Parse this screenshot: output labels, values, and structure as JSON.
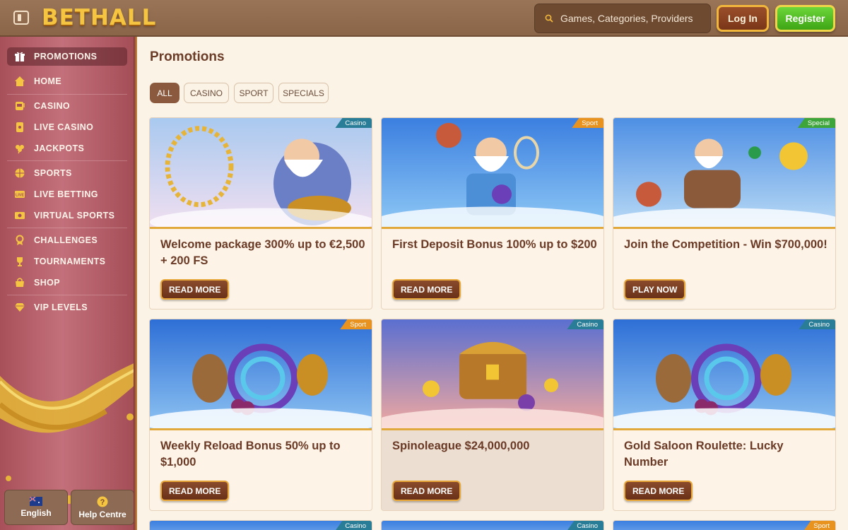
{
  "header": {
    "logo": "BETHALL",
    "search_placeholder": "Games, Categories, Providers",
    "login": "Log In",
    "register": "Register"
  },
  "sidebar": {
    "items": [
      {
        "label": "PROMOTIONS",
        "icon": "gift-icon",
        "active": true
      },
      {
        "label": "HOME",
        "icon": "home-icon"
      },
      {
        "label": "CASINO",
        "icon": "slot-icon"
      },
      {
        "label": "LIVE CASINO",
        "icon": "live-casino-icon"
      },
      {
        "label": "JACKPOTS",
        "icon": "clover-icon"
      },
      {
        "label": "SPORTS",
        "icon": "basketball-icon"
      },
      {
        "label": "LIVE BETTING",
        "icon": "live-icon"
      },
      {
        "label": "VIRTUAL SPORTS",
        "icon": "virtual-icon"
      },
      {
        "label": "CHALLENGES",
        "icon": "challenge-icon"
      },
      {
        "label": "TOURNAMENTS",
        "icon": "trophy-icon"
      },
      {
        "label": "SHOP",
        "icon": "shop-icon"
      },
      {
        "label": "VIP LEVELS",
        "icon": "diamond-icon"
      }
    ],
    "language": "English",
    "help": "Help Centre"
  },
  "main": {
    "title": "Promotions",
    "filters": [
      "ALL",
      "CASINO",
      "SPORT",
      "SPECIALS"
    ],
    "cards": [
      {
        "tag": "Casino",
        "title": "Welcome package 300% up to €2,500 + 200 FS",
        "button": "READ MORE"
      },
      {
        "tag": "Sport",
        "title": "First Deposit Bonus 100% up to $200",
        "button": "READ MORE"
      },
      {
        "tag": "Special",
        "title": "Join the Competition - Win $700,000!",
        "button": "PLAY NOW"
      },
      {
        "tag": "Sport",
        "title": "Weekly Reload Bonus 50% up to $1,000",
        "button": "READ MORE"
      },
      {
        "tag": "Casino",
        "title": "Spinoleague $24,000,000",
        "button": "READ MORE"
      },
      {
        "tag": "Casino",
        "title": "Gold Saloon Roulette: Lucky Number",
        "button": "READ MORE"
      }
    ],
    "partial_tags": [
      "Casino",
      "Casino",
      "Sport"
    ]
  },
  "colors": {
    "casino_tag": "#2a7d96",
    "sport_tag": "#e8921f",
    "special_tag": "#3ea53a"
  }
}
